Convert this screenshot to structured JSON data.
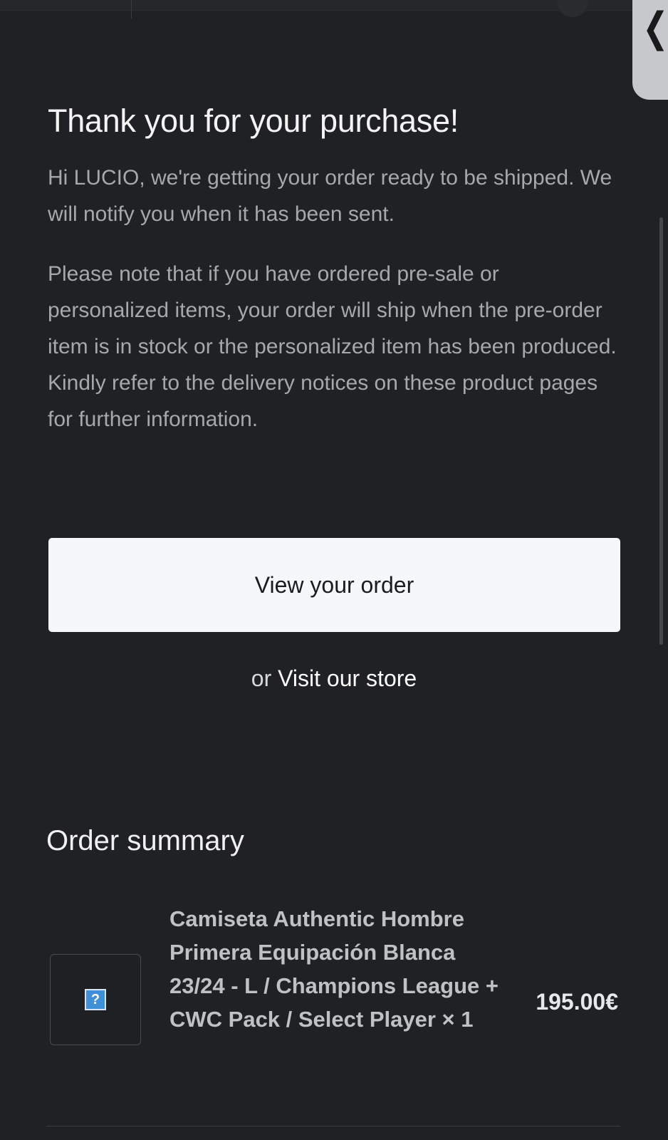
{
  "confirmation": {
    "title": "Thank you for your purchase!",
    "message": "Hi LUCIO, we're getting your order ready to be shipped. We will notify you when it has been sent.",
    "notice": "Please note that if you have ordered pre-sale or personalized items, your order will ship when the pre-order item is in stock or the personalized item has been produced. Kindly refer to the delivery notices on these product pages for further information."
  },
  "actions": {
    "view_order_label": "View your order",
    "visit_prefix": "or",
    "visit_store_label": "Visit our store"
  },
  "order_summary": {
    "title": "Order summary",
    "items": [
      {
        "name": "Camiseta Authentic Hombre Primera Equipación Blanca 23/24 - L / Champions League + CWC Pack / Select Player × 1",
        "price": "195.00€",
        "image_icon": "missing-image-icon"
      }
    ]
  },
  "icons": {
    "back": "chevron-left-icon"
  },
  "colors": {
    "background": "#202124",
    "button_background": "#f5f8fa",
    "body_text": "#a6a8ab"
  }
}
